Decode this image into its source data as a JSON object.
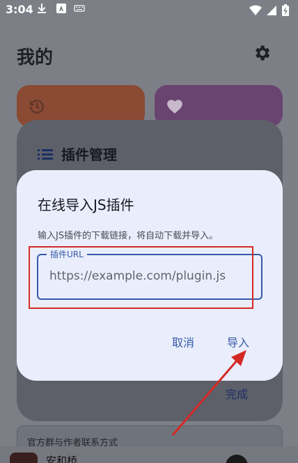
{
  "status_bar": {
    "time": "3:04",
    "icons": [
      "download-icon",
      "app-a-icon",
      "keyboard-icon",
      "wifi-icon",
      "signal-icon",
      "battery-charging-icon"
    ]
  },
  "page": {
    "title": "我的",
    "settings_icon": "gear-icon",
    "cards": [
      {
        "icon": "history-icon",
        "color": "#8a4a33"
      },
      {
        "icon": "heart-icon",
        "color": "#6a4470"
      }
    ]
  },
  "plugin_sheet": {
    "title": "插件管理",
    "icon": "list-icon",
    "done_label": "完成"
  },
  "contact": {
    "label": "官方群与作者联系方式"
  },
  "player": {
    "song_title": "安和桥"
  },
  "dialog": {
    "title": "在线导入JS插件",
    "description": "输入JS插件的下载链接，将自动下载并导入。",
    "field_label": "插件URL",
    "field_placeholder": "https://example.com/plugin.js",
    "field_value": "",
    "cancel_label": "取消",
    "import_label": "导入"
  },
  "colors": {
    "accent": "#355aa6",
    "annotation_red": "#d42a26",
    "dialog_bg": "#eaeefc"
  }
}
